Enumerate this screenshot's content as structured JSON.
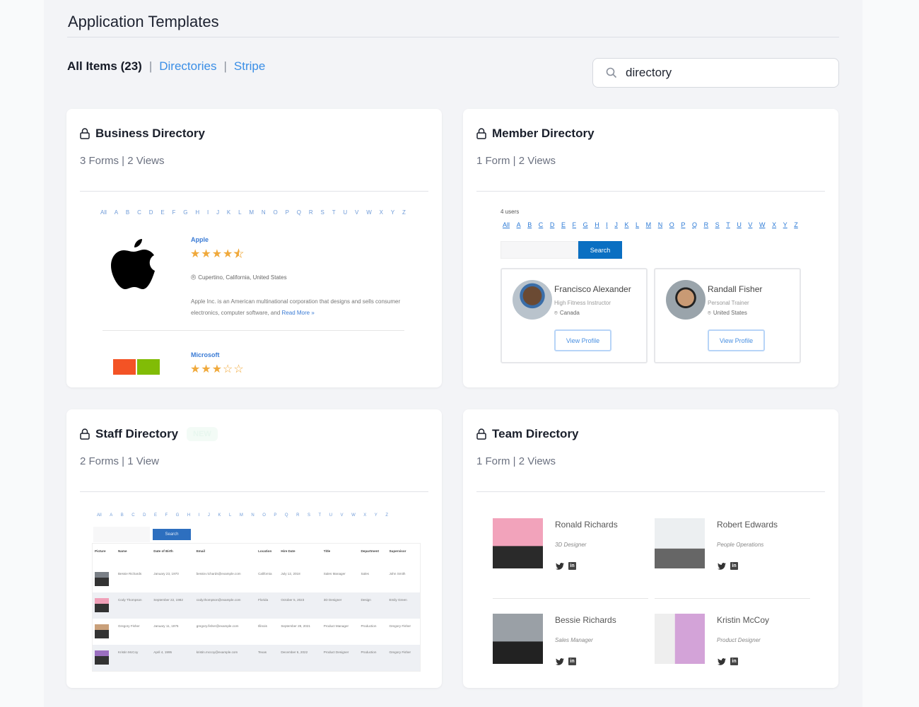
{
  "header": {
    "title": "Application Templates"
  },
  "filters": {
    "all": "All Items (23)",
    "links": [
      "Directories",
      "Stripe"
    ]
  },
  "search": {
    "value": "directory",
    "placeholder": "Search"
  },
  "alphabet": [
    "All",
    "A",
    "B",
    "C",
    "D",
    "E",
    "F",
    "G",
    "H",
    "I",
    "J",
    "K",
    "L",
    "M",
    "N",
    "O",
    "P",
    "Q",
    "R",
    "S",
    "T",
    "U",
    "V",
    "W",
    "X",
    "Y",
    "Z"
  ],
  "cards": [
    {
      "title": "Business Directory",
      "meta": "3 Forms | 2 Views"
    },
    {
      "title": "Member Directory",
      "meta": "1 Form | 2 Views"
    },
    {
      "title": "Staff Directory",
      "meta": "2 Forms | 1 View",
      "badge": "NEW"
    },
    {
      "title": "Team Directory",
      "meta": "1 Form | 2 Views"
    }
  ],
  "business": {
    "entries": [
      {
        "name": "Apple",
        "rating": 4.5,
        "location": "Cupertino, California, United States",
        "description": "Apple Inc. is an American multinational corporation that designs and sells consumer electronics, computer software, and",
        "read_more": "Read More »"
      },
      {
        "name": "Microsoft",
        "rating": 3
      }
    ],
    "brand_colors": {
      "microsoft_red": "#f35325",
      "microsoft_green": "#81bc06"
    }
  },
  "member": {
    "count": "4 users",
    "search_button": "Search",
    "profiles": [
      {
        "name": "Francisco Alexander",
        "title": "High Fitness Instructor",
        "location": "Canada",
        "button": "View Profile"
      },
      {
        "name": "Randall Fisher",
        "title": "Personal Trainer",
        "location": "United States",
        "button": "View Profile"
      }
    ]
  },
  "staff": {
    "search_button": "Search",
    "columns": [
      "Picture",
      "Name",
      "Date of Birth",
      "Email",
      "Location",
      "Hire Date",
      "Title",
      "Department",
      "Supervisor"
    ],
    "rows": [
      [
        "",
        "Bessie Richards",
        "January 23, 1970",
        "bessie.richards@example.com",
        "California",
        "July 12, 2018",
        "Sales Manager",
        "Sales",
        "John Smith"
      ],
      [
        "",
        "Cody Thompson",
        "September 22, 1982",
        "cody.thompson@example.com",
        "Florida",
        "October 5, 2023",
        "3D Designer",
        "Design",
        "Emily Green"
      ],
      [
        "",
        "Gregory Fisher",
        "January 11, 1975",
        "gregory.fisher@example.com",
        "Illinois",
        "September 28, 2021",
        "Product Manager",
        "Production",
        "Gregory Fisher"
      ],
      [
        "",
        "Kristin McCoy",
        "April 4, 1995",
        "kristin.mccoy@example.com",
        "Texas",
        "December 6, 2022",
        "Product Designer",
        "Production",
        "Gregory Fisher"
      ]
    ]
  },
  "team": {
    "members": [
      {
        "name": "Ronald Richards",
        "title": "3D Designer"
      },
      {
        "name": "Robert Edwards",
        "title": "People Operations"
      },
      {
        "name": "Bessie Richards",
        "title": "Sales Manager"
      },
      {
        "name": "Kristin McCoy",
        "title": "Product Designer"
      }
    ]
  },
  "colors": {
    "accent": "#3a8ee6",
    "search_button": "#0a6fc2",
    "star": "#f0a93b"
  }
}
